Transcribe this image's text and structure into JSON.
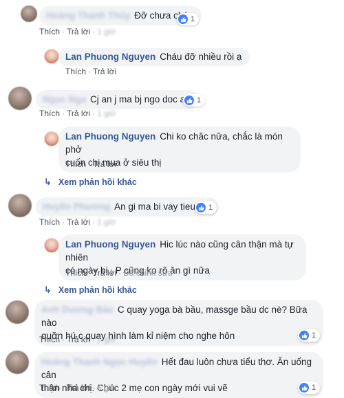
{
  "labels": {
    "like": "Thích",
    "reply": "Trả lời",
    "dot": "·",
    "more_replies": "Xem phản hồi khác",
    "edited": "Đã chỉnh sửa"
  },
  "icons": {
    "like": "like-icon",
    "reply_arrow": "reply-arrow-icon"
  },
  "colors": {
    "name_link": "#365899",
    "bubble_bg": "#f2f3f5",
    "like_blue": "#4080ff"
  },
  "comments": [
    {
      "author": "Hoàng Thanh Thủy",
      "text": "Đỡ chưa cháu",
      "time": "1 giờ",
      "reactions": "1",
      "reply": {
        "author": "Lan Phuong Nguyen",
        "text": "Cháu đỡ nhiều rồi ạ"
      }
    },
    {
      "author": "Ngọc Nga",
      "text": "Cj an j ma bj ngo doc ak",
      "time": "1 giờ",
      "reactions": "1",
      "reply": {
        "author": "Lan Phuong Nguyen",
        "line1": "Chi ko chăc nữa, chắc là món phở",
        "line2": "cuốn chị mua ở siêu thị"
      }
    },
    {
      "author": "Huyền Phương",
      "text": "An gi ma bi vay tieu thu",
      "time": "1 giờ",
      "reactions": "1",
      "reply": {
        "author": "Lan Phuong Nguyen",
        "line1": "Hic lúc nào cũng cân thận mà tự nhiên",
        "line2": "có ngày bị , P cũng ko rõ ăn gì nữa"
      }
    },
    {
      "author": "Anh Dương Bảo",
      "line1": "C quay yoga bà bầu, massge bầu dc nè? Bữa nào",
      "line2": "quỡn hú c quay hình làm kỉ niệm cho nghe hôn",
      "time": "1 giờ",
      "reactions": "1"
    },
    {
      "author": "Hoàng Thanh Ngọc Huyền",
      "line1": "Hết đau luôn chưa tiểu thơ. Ăn uống cân",
      "line2": "thận nha chị. Chúc 2 mẹ con ngày mới vui vẽ",
      "time": "5 giờ",
      "reactions": "1"
    }
  ]
}
